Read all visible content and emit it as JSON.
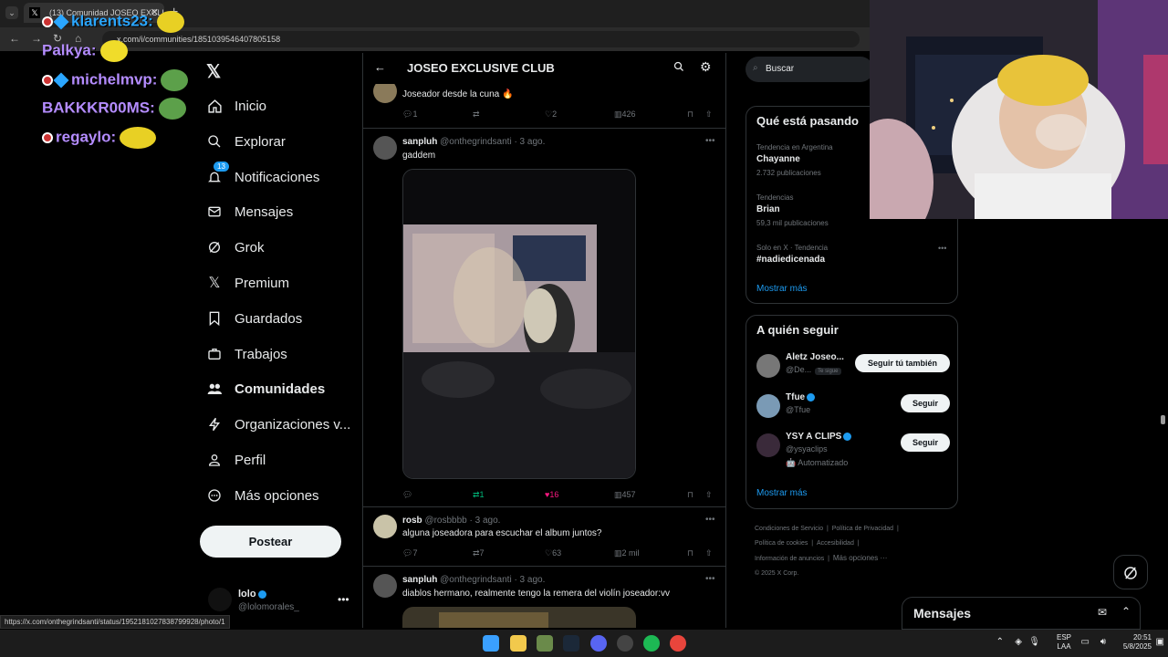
{
  "browser": {
    "tab_title": "(13) Comunidad JOSEO EXCLU...",
    "url": "x.com/i/communities/1851039546407805158",
    "status_url": "https://x.com/onthegrindsanti/status/1952181027838799928/photo/1"
  },
  "chat_overlay": [
    {
      "user": "klarents23:"
    },
    {
      "user": "Palkya:"
    },
    {
      "user": "michelmvp:"
    },
    {
      "user": "BAKKKR00MS:"
    },
    {
      "user": "regaylo:"
    }
  ],
  "nav": {
    "items": [
      {
        "label": "Inicio",
        "icon": "home-icon"
      },
      {
        "label": "Explorar",
        "icon": "search-icon"
      },
      {
        "label": "Notificaciones",
        "icon": "bell-icon",
        "badge": "13"
      },
      {
        "label": "Mensajes",
        "icon": "mail-icon"
      },
      {
        "label": "Grok",
        "icon": "grok-icon"
      },
      {
        "label": "Premium",
        "icon": "x-logo-icon"
      },
      {
        "label": "Guardados",
        "icon": "bookmark-icon"
      },
      {
        "label": "Trabajos",
        "icon": "briefcase-icon"
      },
      {
        "label": "Comunidades",
        "icon": "communities-icon"
      },
      {
        "label": "Organizaciones v...",
        "icon": "lightning-icon"
      },
      {
        "label": "Perfil",
        "icon": "person-icon"
      },
      {
        "label": "Más opciones",
        "icon": "more-circle-icon"
      }
    ],
    "post_label": "Postear",
    "profile": {
      "name": "lolo",
      "handle": "@lolomorales_"
    }
  },
  "header": {
    "title": "JOSEO EXCLUSIVE CLUB"
  },
  "posts": [
    {
      "text": "Joseador desde la cuna 🔥",
      "replies": "1",
      "reposts": "",
      "likes": "2",
      "views": "426"
    },
    {
      "name": "sanpluh",
      "handle": "@onthegrindsanti",
      "time": "· 3 ago.",
      "text": "gaddem",
      "replies": "",
      "reposts": "1",
      "likes": "16",
      "views": "457"
    },
    {
      "name": "rosb",
      "handle": "@rosbbbb",
      "time": "· 3 ago.",
      "text": "alguna joseadora para escuchar el album juntos?",
      "replies": "7",
      "reposts": "7",
      "likes": "63",
      "views": "2 mil"
    },
    {
      "name": "sanpluh",
      "handle": "@onthegrindsanti",
      "time": "· 3 ago.",
      "text": "diablos hermano, realmente tengo la remera del violín joseador:vv"
    }
  ],
  "right": {
    "search_placeholder": "Buscar",
    "trends_title": "Qué está pasando",
    "trends": [
      {
        "meta": "Tendencia en Argentina",
        "name": "Chayanne",
        "count": "2.732 publicaciones"
      },
      {
        "meta": "Tendencias",
        "name": "Brian",
        "count": "59,3 mil publicaciones"
      },
      {
        "meta": "Solo en X · Tendencia",
        "name": "#nadiedicenada",
        "count": ""
      }
    ],
    "trends_more": "Mostrar más",
    "follow_title": "A quién seguir",
    "follow": [
      {
        "name": "Aletz Joseo...",
        "handle": "@De...",
        "tag": "Te sigue",
        "button": "Seguir tú también"
      },
      {
        "name": "Tfue",
        "handle": "@Tfue",
        "button": "Seguir"
      },
      {
        "name": "YSY A CLIPS",
        "handle": "@ysyaclips",
        "extra": "🤖 Automatizado",
        "button": "Seguir"
      }
    ],
    "follow_more": "Mostrar más",
    "footer": [
      "Condiciones de Servicio",
      "|",
      "Política de Privacidad",
      "|",
      "Política de cookies",
      "|",
      "Accesibilidad",
      "|",
      "Información de anuncios",
      "|",
      "Más opciones ···",
      "© 2025 X Corp."
    ],
    "messages_label": "Mensajes"
  },
  "taskbar": {
    "lang": "ESP",
    "lang2": "LAA",
    "time": "20:51",
    "date": "5/8/2025"
  }
}
